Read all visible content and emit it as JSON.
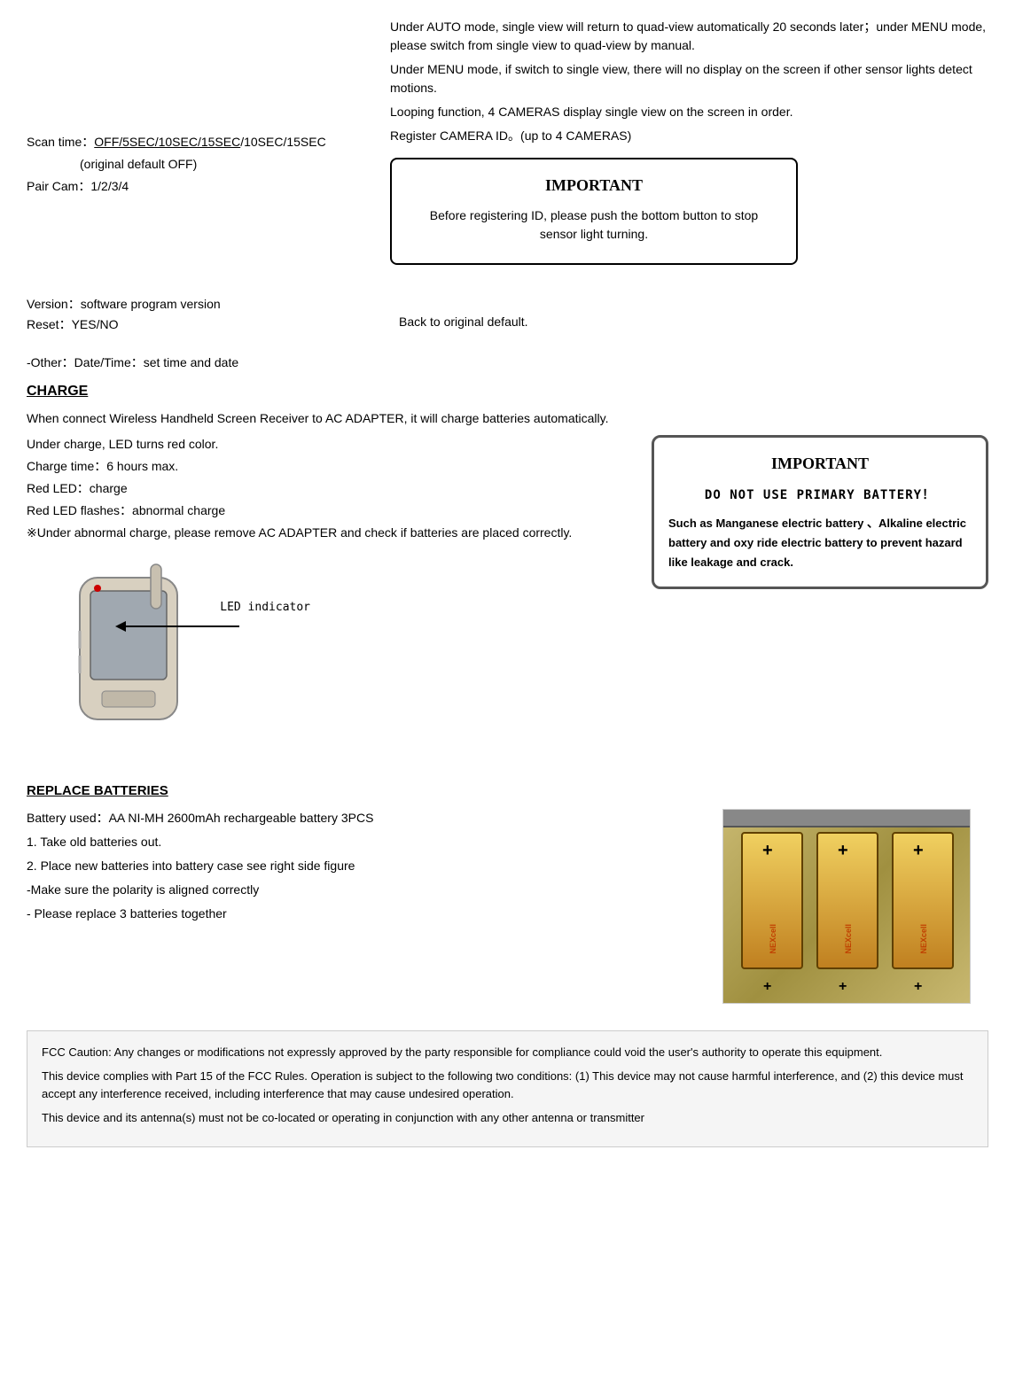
{
  "top": {
    "auto_mode_text": "Under AUTO mode, single view will return to quad-view automatically 20 seconds later；under MENU mode, please switch from single view to quad-view by manual.",
    "menu_mode_text": "Under MENU mode, if switch to single view, there will no display on the screen if other sensor lights detect motions.",
    "looping_text": "Looping function, 4 CAMERAS display single view on the screen in order.",
    "register_text": "Register CAMERA ID。(up to 4 CAMERAS)",
    "scan_time_label": "Scan time：",
    "scan_time_value": "OFF/5SEC/10SEC/15SEC",
    "scan_time_default": "(original default OFF)",
    "pair_cam_label": "Pair Cam：",
    "pair_cam_value": "1/2/3/4"
  },
  "important1": {
    "title": "IMPORTANT",
    "body": "Before registering ID, please push the bottom button to stop sensor light turning."
  },
  "version": {
    "version_label": "Version：",
    "version_value": "software program version",
    "reset_label": "Reset：",
    "reset_value": "YES/NO",
    "back_text": "Back to original default.",
    "other_text": "-Other：Date/Time：set time and date"
  },
  "charge": {
    "title": "CHARGE ",
    "line1": "When connect Wireless Handheld Screen Receiver to AC ADAPTER, it will charge batteries automatically.",
    "line2": "Under charge, LED turns red color.",
    "line3": "Charge time：6 hours max.",
    "line4": "Red LED：charge",
    "line5": "Red LED flashes：abnormal charge",
    "line6": "※Under abnormal charge, please remove AC ADAPTER and check if batteries are placed correctly.",
    "led_label": "LED indicator"
  },
  "important2": {
    "title": "IMPORTANT",
    "do_not": "DO NOT USE PRIMARY BATTERY！",
    "body": "Such as Manganese electric battery 、Alkaline electric battery and oxy ride electric battery to prevent hazard like leakage and crack."
  },
  "replace": {
    "title": "REPLACE BATTERIES",
    "battery_used": "Battery used：AA NI-MH 2600mAh rechargeable battery 3PCS",
    "step1": "1. Take old batteries out.",
    "step2": "2. Place new batteries into battery case see right side figure",
    "step2b": " -Make sure the polarity is aligned correctly",
    "step3": " - Please replace 3 batteries together"
  },
  "fcc": {
    "line1": "FCC Caution: Any changes or modifications not expressly approved by the party responsible for compliance could void the user's authority to operate this equipment.",
    "line2": "This device complies with Part 15 of the FCC Rules. Operation is subject to the following two conditions: (1) This device may not cause harmful interference, and (2) this device must accept any interference received, including interference that may cause undesired operation.",
    "line3": "This device and its antenna(s) must not be co-located or operating in conjunction with any other antenna or transmitter"
  }
}
